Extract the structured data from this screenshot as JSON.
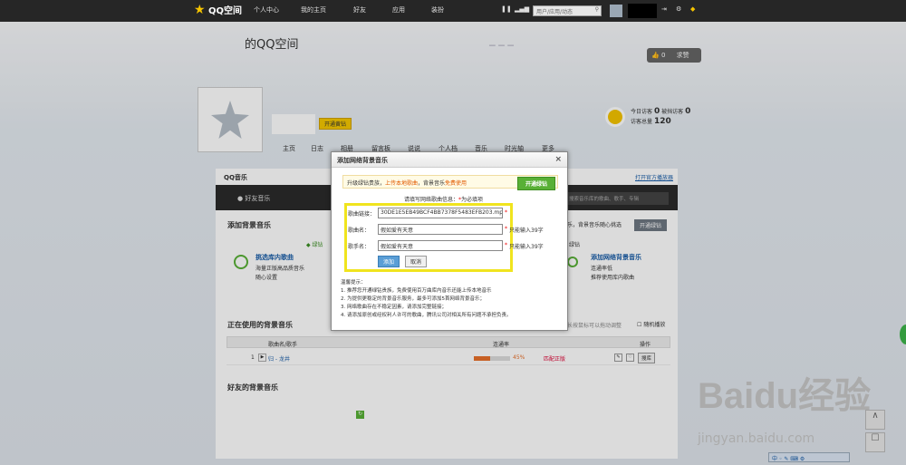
{
  "topbar": {
    "logo": "QQ空间",
    "nav": [
      "个人中心",
      "我的主页",
      "好友",
      "应用",
      "装扮"
    ],
    "search_placeholder": "用户/应用/动态"
  },
  "profile": {
    "title": "的QQ空间",
    "vip_btn": "开通黄钻",
    "like_count": "0",
    "like_label": "求赞",
    "today_visits_label": "今日访客",
    "today_visits": "0",
    "blocked_label": "被挡访客",
    "blocked": "0",
    "total_label": "访客总量",
    "total": "120"
  },
  "nav": [
    "主页",
    "日志",
    "相册",
    "留言板",
    "说说",
    "个人档",
    "音乐",
    "时光轴",
    "更多"
  ],
  "music": {
    "header": "QQ音乐",
    "open_official": "打开官方播放器",
    "friend_music": "好友音乐",
    "tabs_right": "搜索音乐库的歌曲、歌手、专辑",
    "add_bg": "添加背景音乐",
    "vip_text": "绿钻",
    "tip_right": "乐，背景音乐随心挑选",
    "open_green": "开通绿钻",
    "pick_lib": "挑选库内歌曲",
    "pick_lib_sub1": "海量正版高品质音乐",
    "pick_lib_sub2": "随心设置",
    "add_net": "添加网络背景音乐",
    "add_net_sub1": "连通率低",
    "add_net_sub2": "推荐使用库内歌曲",
    "vip_right": "绿钻",
    "using": "正在使用的背景音乐",
    "drag_tip": "长按鼠标可以拖动调整",
    "random": "随机播放",
    "col_song": "歌曲名/歌手",
    "col_rate": "连通率",
    "col_op": "操作",
    "song_index": "1",
    "song_name": "归 - 龙井",
    "rate": "45%",
    "rate_value": 0.45,
    "status": "匹配正版",
    "op_btn": "搜库",
    "friends_bg": "好友的背景音乐"
  },
  "dialog": {
    "title": "添加网络背景音乐",
    "close": "×",
    "promo_a": "升级绿钻贵族，",
    "promo_b": "上传本地歌曲",
    "promo_c": "，背景音乐",
    "promo_d": "免费使用",
    "promo_btn": "开通绿钻",
    "hint": "请填写网络歌曲信息：",
    "required_mark": "*",
    "required_text": "为必填项",
    "url_label": "歌曲链接：",
    "url_value": "30DE1E5EB49BCF4BB7378F5483EFB203.mp3",
    "name_label": "歌曲名：",
    "name_value": "假如爱有天意",
    "name_hint": "只能输入39字",
    "singer_label": "歌手名：",
    "singer_value": "假如爱有天意",
    "singer_hint": "只能输入39字",
    "add_btn": "添加",
    "cancel_btn": "取消",
    "tips_title": "温馨提示：",
    "tip1": "1. 推荐您开通绿钻贵族，免费使用百万曲库内音乐还能上传本地音乐",
    "tip2": "2. 为提供更稳定的背景音乐服务，最多可添加5首网络背景音乐；",
    "tip3": "3. 网络歌曲存在不稳定因素，请添加完整链接；",
    "tip4": "4. 请添加原创或经权利人许可的歌曲，腾讯公司对相关所有问题不承担负责。"
  },
  "watermark": {
    "brand": "Baidu经验",
    "url": "jingyan.baidu.com"
  }
}
